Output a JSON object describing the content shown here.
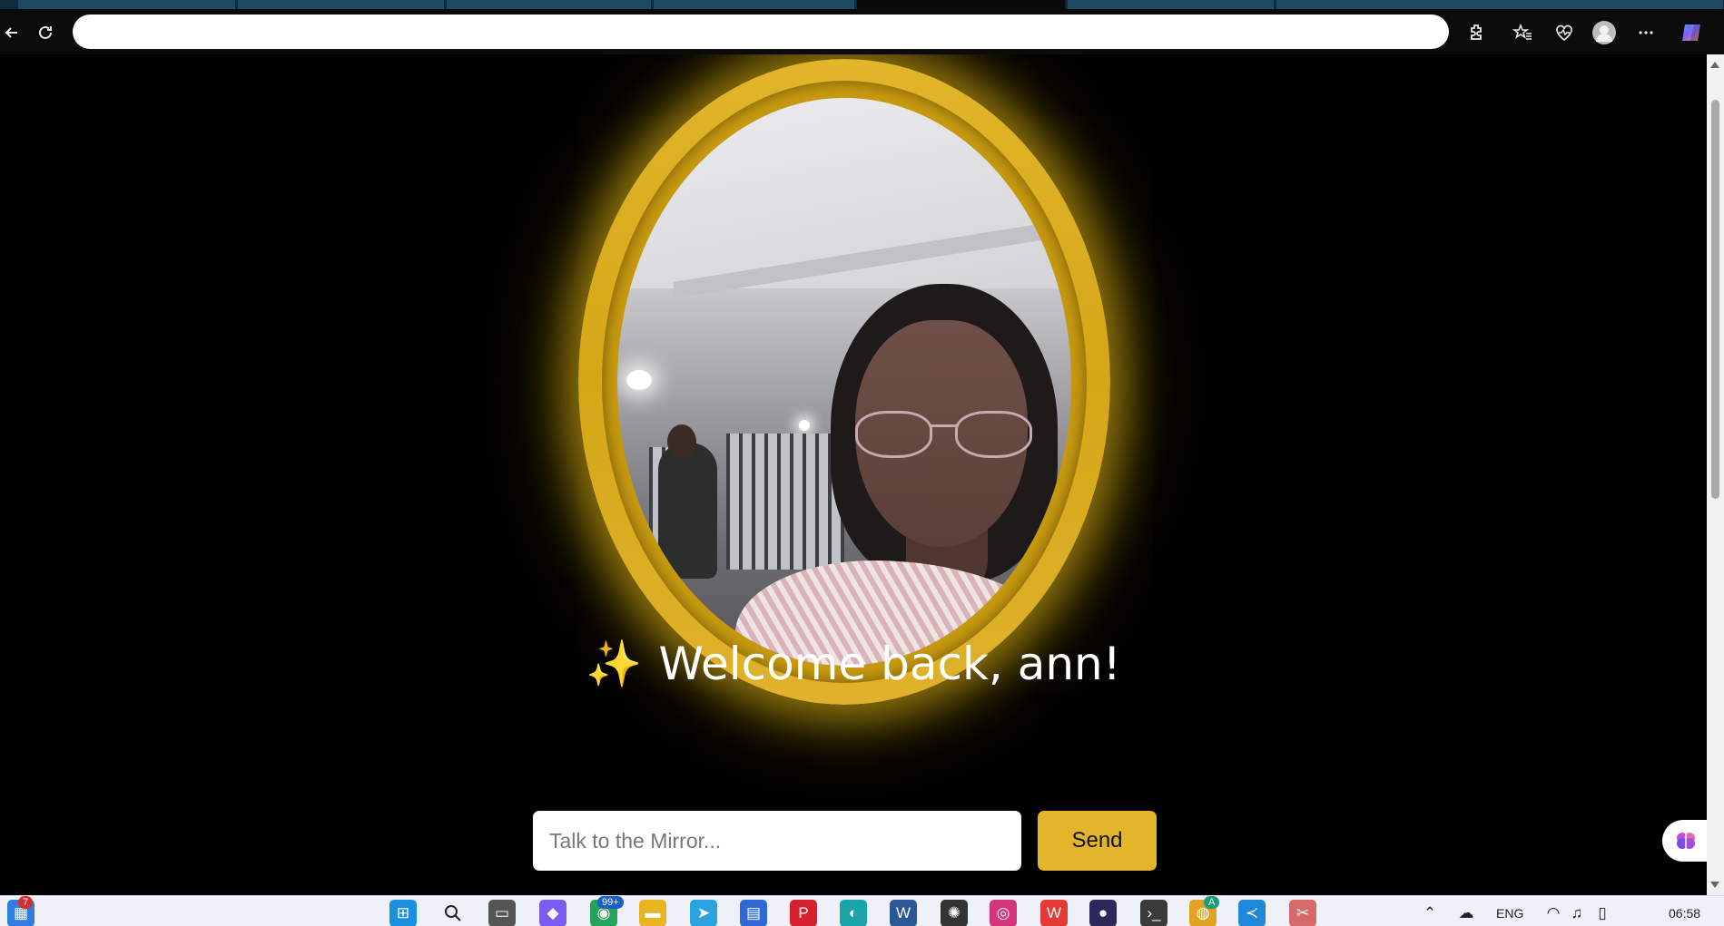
{
  "browser": {
    "address_value": "",
    "icons": [
      "back-icon",
      "refresh-icon",
      "extensions-icon",
      "favorites-icon",
      "health-icon",
      "profile-icon",
      "more-icon",
      "copilot-icon"
    ]
  },
  "page": {
    "welcome_emoji": "✨",
    "welcome_text": "Welcome back, ann!",
    "chat": {
      "placeholder": "Talk to the Mirror...",
      "value": "",
      "send_label": "Send"
    },
    "colors": {
      "background": "#000000",
      "accent": "#e2b52a"
    }
  },
  "taskbar": {
    "start_badge": "7",
    "whatsapp_badge": "99+",
    "chrome_badge": "A",
    "language": "ENG",
    "time": "06:58",
    "apps": [
      "start-icon",
      "search-icon",
      "task-view-icon",
      "copilot-app-icon",
      "whatsapp-icon",
      "file-explorer-icon",
      "telegram-icon",
      "store-icon",
      "pinterest-icon",
      "edge-icon",
      "word-icon",
      "chatgpt-icon",
      "instagram-icon",
      "wps-icon",
      "app-icon",
      "terminal-icon",
      "chrome-icon",
      "vscode-icon",
      "snipping-tool-icon"
    ]
  }
}
